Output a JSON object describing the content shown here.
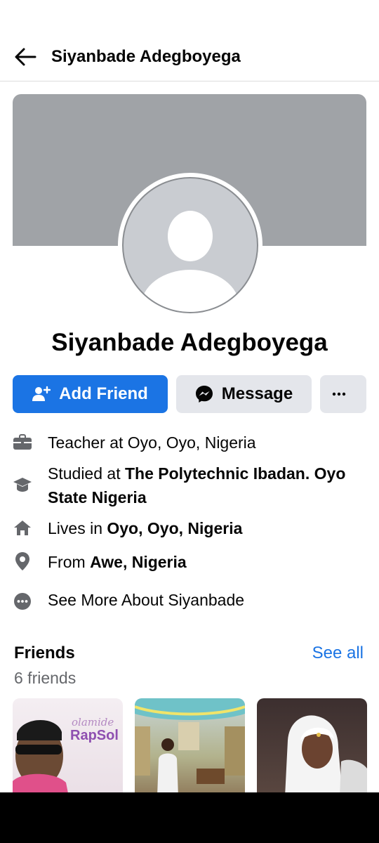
{
  "header": {
    "title": "Siyanbade Adegboyega"
  },
  "profile": {
    "name": "Siyanbade Adegboyega"
  },
  "actions": {
    "add_friend": "Add Friend",
    "message": "Message"
  },
  "about": {
    "work": {
      "text": "Teacher at Oyo, Oyo, Nigeria"
    },
    "education": {
      "prefix": "Studied at ",
      "bold": "The Polytechnic Ibadan. Oyo State Nigeria"
    },
    "lives": {
      "prefix": "Lives in ",
      "bold": "Oyo, Oyo, Nigeria"
    },
    "from": {
      "prefix": "From ",
      "bold": "Awe, Nigeria"
    },
    "see_more": "See More About Siyanbade"
  },
  "friends": {
    "title": "Friends",
    "count": "6 friends",
    "see_all": "See all",
    "thumb1_text_script": "olamide",
    "thumb1_text": "RapSol"
  },
  "colors": {
    "accent": "#1b74e4",
    "cover": "#a0a3a7",
    "secondary_btn": "#e4e6eb"
  }
}
